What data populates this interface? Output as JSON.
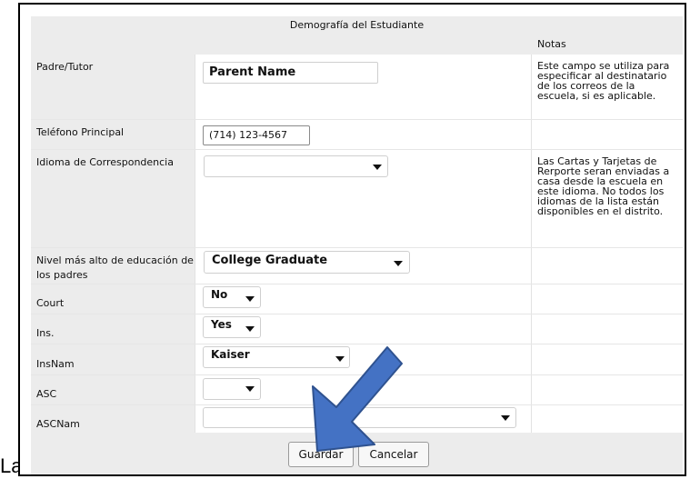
{
  "header": {
    "title": "Demografía del Estudiante",
    "notes_label": "Notas"
  },
  "rows": {
    "parent": {
      "label": "Padre/Tutor",
      "value": "Parent Name",
      "note": "Este campo se utiliza para especificar al destinatario de los correos de la escuela, si es aplicable."
    },
    "phone": {
      "label": "Teléfono Principal",
      "value": "(714) 123-4567"
    },
    "language": {
      "label": "Idioma de Correspondencia",
      "value": "",
      "note": "Las Cartas y Tarjetas de Rerporte seran enviadas a casa desde la escuela en este idioma. No todos los idiomas de la lista están disponibles en el distrito."
    },
    "education": {
      "label": "Nivel más alto de educación de los padres",
      "value": "College Graduate"
    },
    "court": {
      "label": "Court",
      "value": "No"
    },
    "ins": {
      "label": "Ins.",
      "value": "Yes"
    },
    "insnam": {
      "label": "InsNam",
      "value": "Kaiser"
    },
    "asc": {
      "label": "ASC",
      "value": ""
    },
    "ascnam": {
      "label": "ASCNam",
      "value": ""
    }
  },
  "buttons": {
    "save": "Guardar",
    "cancel": "Cancelar"
  },
  "overlay": {
    "bottom_text": "La"
  },
  "colors": {
    "arrow_fill": "#4472c4",
    "arrow_stroke": "#2f528f",
    "panel_gray": "#ececec"
  },
  "icons": {
    "dropdown": "chevron-down-icon",
    "pointer": "arrow-annotation"
  }
}
